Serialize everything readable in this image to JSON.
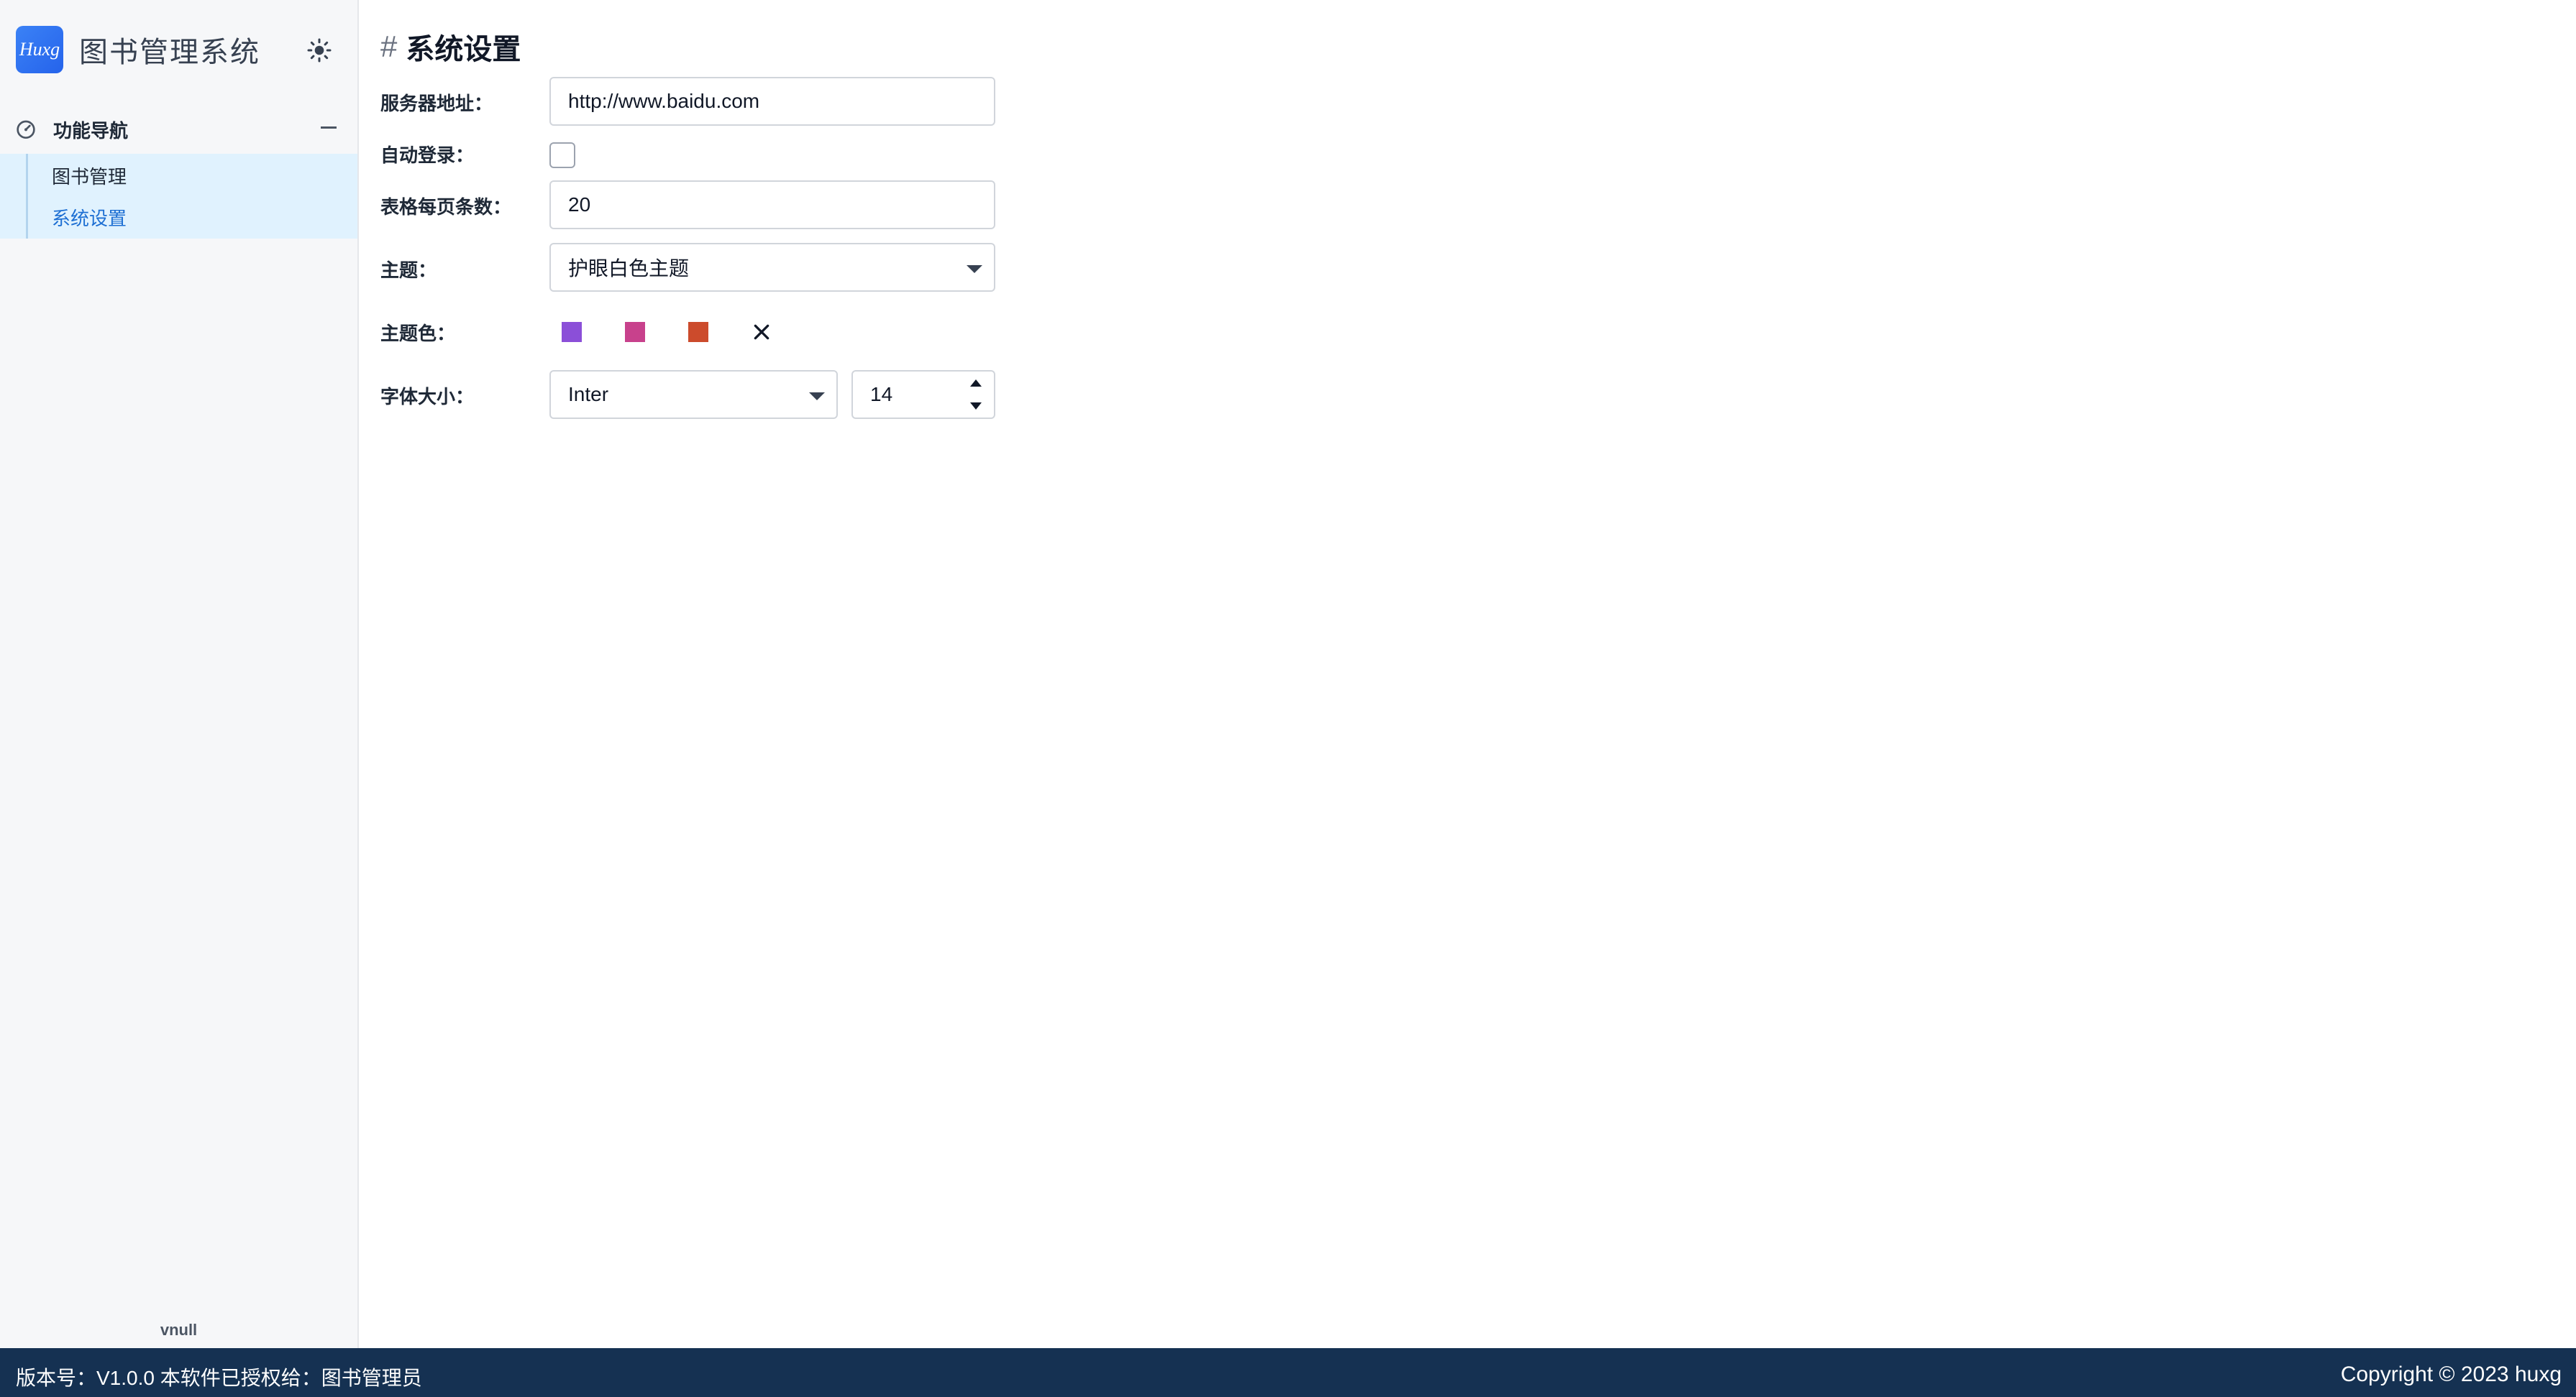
{
  "brand": {
    "logo_text": "Huxg",
    "title": "图书管理系统"
  },
  "icons": {
    "theme_toggle": "sun-icon",
    "nav_group": "dashboard-gauge-icon",
    "nav_collapse": "minus-icon",
    "color_clear": "close-icon",
    "step_up": "caret-up-icon",
    "step_down": "caret-down-icon"
  },
  "sidebar": {
    "group_label": "功能导航",
    "items": [
      {
        "label": "图书管理",
        "active": false
      },
      {
        "label": "系统设置",
        "active": true
      }
    ],
    "footer": "vnull"
  },
  "page": {
    "title_prefix": "#",
    "title": "系统设置"
  },
  "form": {
    "server_label": "服务器地址：",
    "server_value": "http://www.baidu.com",
    "autologin_label": "自动登录：",
    "autologin_checked": false,
    "pagesize_label": "表格每页条数：",
    "pagesize_value": "20",
    "theme_label": "主题：",
    "theme_value": "护眼白色主题",
    "themecolor_label": "主题色：",
    "theme_colors": [
      "#8b4fd8",
      "#c8418c",
      "#cc4b2c"
    ],
    "fontsize_label": "字体大小：",
    "font_family_value": "Inter",
    "font_size_value": "14"
  },
  "footer": {
    "left": "版本号：V1.0.0 本软件已授权给：图书管理员",
    "right": "Copyright © 2023 huxg"
  },
  "colors": {
    "accent": "#1d6fd3",
    "nav_active_bg": "#e0f2fe",
    "footer_bg": "#153152"
  }
}
